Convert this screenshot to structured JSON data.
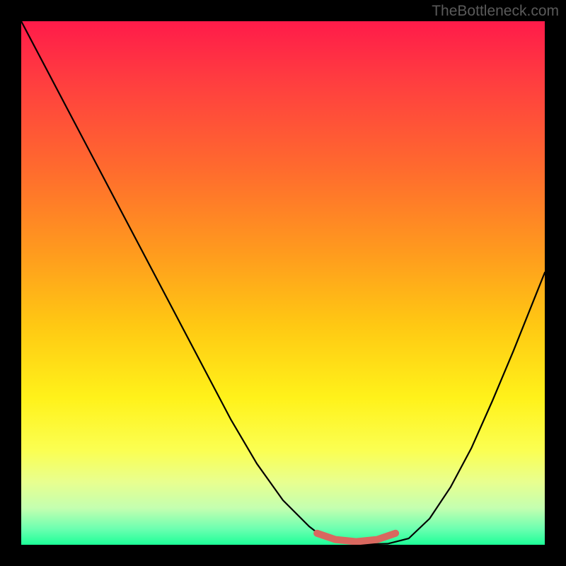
{
  "watermark": "TheBottleneck.com",
  "chart_data": {
    "type": "line",
    "title": "",
    "xlabel": "",
    "ylabel": "",
    "xlim": [
      0,
      1
    ],
    "ylim": [
      0,
      1
    ],
    "background": {
      "kind": "vertical-gradient",
      "stops": [
        {
          "offset": 0.0,
          "color": "#ff1b4a"
        },
        {
          "offset": 0.12,
          "color": "#ff3f3f"
        },
        {
          "offset": 0.28,
          "color": "#ff6a2e"
        },
        {
          "offset": 0.44,
          "color": "#ff9a1e"
        },
        {
          "offset": 0.58,
          "color": "#ffc813"
        },
        {
          "offset": 0.72,
          "color": "#fff21a"
        },
        {
          "offset": 0.82,
          "color": "#fbff52"
        },
        {
          "offset": 0.88,
          "color": "#e8ff8f"
        },
        {
          "offset": 0.93,
          "color": "#c4ffb0"
        },
        {
          "offset": 0.97,
          "color": "#6bffb0"
        },
        {
          "offset": 1.0,
          "color": "#1dff98"
        }
      ]
    },
    "series": [
      {
        "name": "bottleneck-curve",
        "color": "#000000",
        "width": 2.2,
        "x": [
          0.0,
          0.05,
          0.1,
          0.15,
          0.2,
          0.25,
          0.3,
          0.35,
          0.4,
          0.45,
          0.5,
          0.55,
          0.58,
          0.62,
          0.66,
          0.7,
          0.74,
          0.78,
          0.82,
          0.86,
          0.9,
          0.94,
          0.98,
          1.0
        ],
        "y": [
          1.0,
          0.905,
          0.81,
          0.715,
          0.62,
          0.525,
          0.43,
          0.335,
          0.24,
          0.155,
          0.085,
          0.035,
          0.012,
          0.003,
          0.001,
          0.002,
          0.012,
          0.05,
          0.11,
          0.185,
          0.275,
          0.37,
          0.47,
          0.52
        ]
      },
      {
        "name": "target-band",
        "color": "#d9685f",
        "width": 10,
        "cap": "round",
        "x": [
          0.565,
          0.6,
          0.64,
          0.68,
          0.715
        ],
        "y": [
          0.022,
          0.01,
          0.006,
          0.01,
          0.022
        ]
      }
    ]
  }
}
